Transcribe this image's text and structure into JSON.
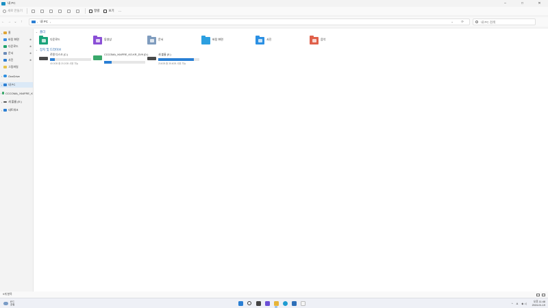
{
  "window": {
    "title": "내 PC",
    "controls": [
      "–",
      "□",
      "✕"
    ]
  },
  "toolbar": {
    "new_label": "새로 만들기",
    "sort_label": "정렬",
    "view_label": "보기",
    "more_label": "···"
  },
  "address": {
    "crumb": "내 PC",
    "chevron": "›",
    "tail": "⌄ ⟳"
  },
  "search": {
    "placeholder": "내 PC 검색"
  },
  "nav": {
    "back": "←",
    "forward": "→",
    "up_dropdown": "⌄",
    "up": "↑"
  },
  "sidebar": {
    "items": [
      {
        "label": "홈",
        "arrow": "⌄",
        "color": "#e0a536",
        "pin": ""
      },
      {
        "label": "바탕 화면",
        "arrow": "",
        "color": "#3a8ee6",
        "pin": "✱"
      },
      {
        "label": "다운로드",
        "arrow": "",
        "color": "#1fa36b",
        "pin": "✱"
      },
      {
        "label": "문서",
        "arrow": "",
        "color": "#6b8bb8",
        "pin": "✱"
      },
      {
        "label": "사진",
        "arrow": "",
        "color": "#2c7fd3",
        "pin": "✱"
      },
      {
        "label": "그림파일",
        "arrow": "",
        "color": "#e6c34a",
        "pin": ""
      },
      {
        "label": "OneDrive",
        "arrow": "›",
        "color": "#2c8ee0",
        "pin": ""
      },
      {
        "label": "내 PC",
        "arrow": "›",
        "color": "#2c7fd3",
        "pin": ""
      },
      {
        "label": "CCCOMA_X64FRE_K",
        "arrow": "›",
        "color": "#3aa86b",
        "pin": ""
      },
      {
        "label": "새 볼륨 (E:)",
        "arrow": "›",
        "color": "#555555",
        "pin": ""
      },
      {
        "label": "네트워크",
        "arrow": "›",
        "color": "#2c7fd3",
        "pin": ""
      }
    ]
  },
  "main": {
    "folders_header": "폴더",
    "folders": [
      {
        "label": "다운로드",
        "color": "#1aa37a"
      },
      {
        "label": "동영상",
        "color": "#8a4fd6"
      },
      {
        "label": "문서",
        "color": "#7f9cbe"
      },
      {
        "label": "바탕 화면",
        "color": "#2c9fe0"
      },
      {
        "label": "사진",
        "color": "#2b90e3"
      },
      {
        "label": "음악",
        "color": "#e0604a"
      }
    ],
    "drives_header": "장치 및 드라이브",
    "drives": [
      {
        "name": "로컬 디스크 (C:)",
        "free": "40.0GB 중 20.2GB 사용 가능",
        "used_fraction": 0.12
      },
      {
        "name": "CCCOMA_X64FRE_KO-KR_DV9 (D:)",
        "free": "",
        "used_fraction": 0.18
      },
      {
        "name": "새 볼륨 (E:)",
        "free": "216GB 중 35.6GB 사용 가능",
        "used_fraction": 0.86
      }
    ]
  },
  "status": {
    "count": "9개 항목"
  },
  "taskbar": {
    "weather_temp": "8°C",
    "weather_desc": "흐림",
    "apps": [
      {
        "name": "start",
        "color": "#2a7fd4"
      },
      {
        "name": "search",
        "color": "#3a3a3a"
      },
      {
        "name": "task-view",
        "color": "#444444"
      },
      {
        "name": "widgets",
        "color": "#6b4fd6"
      },
      {
        "name": "explorer",
        "color": "#e6b43a"
      },
      {
        "name": "edge",
        "color": "#1f9bd1"
      },
      {
        "name": "store",
        "color": "#2d6fb8"
      },
      {
        "name": "notepad",
        "color": "#cfcfcf"
      }
    ],
    "tray_caret": "^",
    "tray_lang": "A",
    "tray_icons": "◈ ◁",
    "time": "오후 11:48",
    "date": "2024-01-19"
  }
}
